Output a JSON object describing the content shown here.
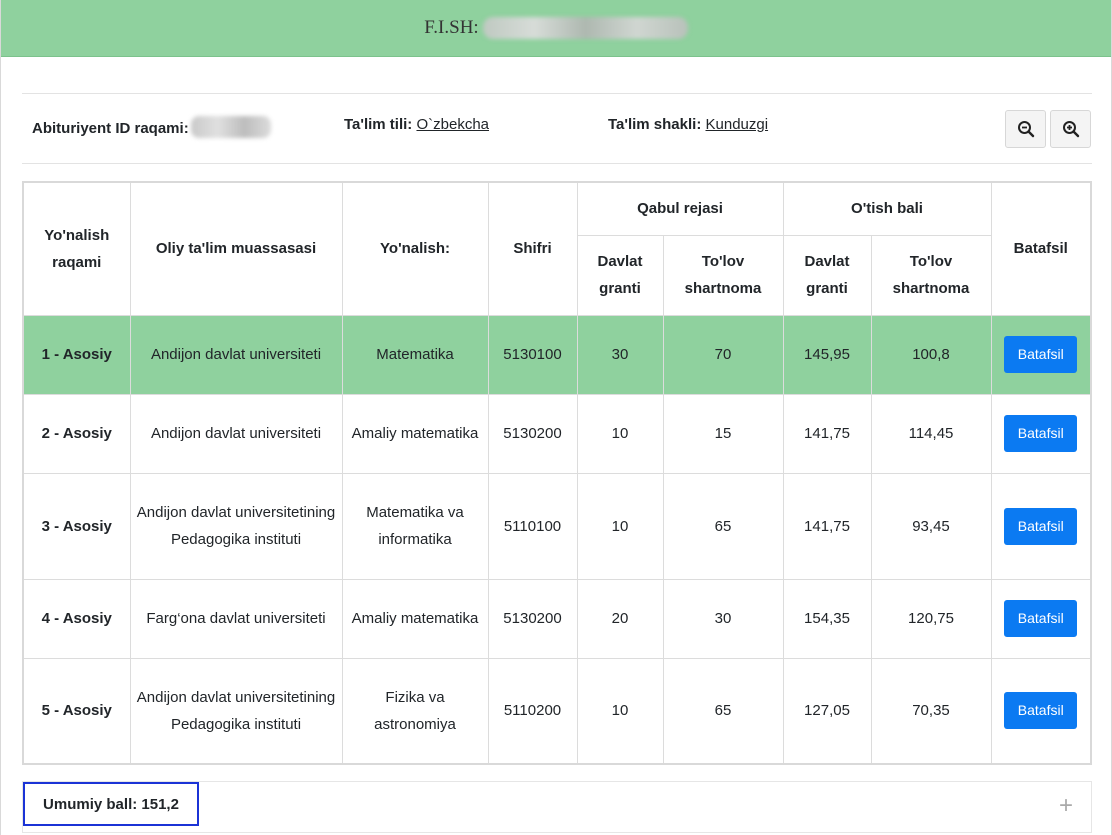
{
  "header": {
    "label": "F.I.SH:"
  },
  "info": {
    "id_label": "Abituriyent ID raqami:",
    "lang_label": "Ta'lim tili:",
    "lang_value": "O`zbekcha",
    "form_label": "Ta'lim shakli:",
    "form_value": "Kunduzgi"
  },
  "icons": {
    "zoom_out": "zoom-out-icon",
    "zoom_in": "zoom-in-icon",
    "expand": "plus-icon"
  },
  "table": {
    "headers": {
      "num": "Yo'nalish raqami",
      "oty": "Oliy ta'lim muassasasi",
      "dir": "Yo'nalish:",
      "code": "Shifri",
      "plan": "Qabul rejasi",
      "pass": "O'tish bali",
      "detail": "Batafsil",
      "grant": "Davlat granti",
      "contract": "To'lov shartnoma",
      "grant2": "Davlat granti",
      "contract2": "To'lov shartnoma"
    },
    "rows": [
      {
        "rank": "1 - Asosiy",
        "oty": "Andijon davlat universiteti",
        "dir": "Matematika",
        "code": "5130100",
        "plan_grant": "30",
        "plan_contract": "70",
        "pass_grant": "145,95",
        "pass_contract": "100,8",
        "button": "Batafsil"
      },
      {
        "rank": "2 - Asosiy",
        "oty": "Andijon davlat universiteti",
        "dir": "Amaliy matematika",
        "code": "5130200",
        "plan_grant": "10",
        "plan_contract": "15",
        "pass_grant": "141,75",
        "pass_contract": "114,45",
        "button": "Batafsil"
      },
      {
        "rank": "3 - Asosiy",
        "oty": "Andijon davlat universitetining Pedagogika instituti",
        "dir": "Matematika va informatika",
        "code": "5110100",
        "plan_grant": "10",
        "plan_contract": "65",
        "pass_grant": "141,75",
        "pass_contract": "93,45",
        "button": "Batafsil"
      },
      {
        "rank": "4 - Asosiy",
        "oty": "Farg‘ona davlat universiteti",
        "dir": "Amaliy matematika",
        "code": "5130200",
        "plan_grant": "20",
        "plan_contract": "30",
        "pass_grant": "154,35",
        "pass_contract": "120,75",
        "button": "Batafsil"
      },
      {
        "rank": "5 - Asosiy",
        "oty": "Andijon davlat universitetining Pedagogika instituti",
        "dir": "Fizika va astronomiya",
        "code": "5110200",
        "plan_grant": "10",
        "plan_contract": "65",
        "pass_grant": "127,05",
        "pass_contract": "70,35",
        "button": "Batafsil"
      }
    ]
  },
  "footer": {
    "total": "Umumiy ball: 151,2",
    "expand_symbol": "+"
  },
  "colors": {
    "header_bg": "#8fd19e",
    "highlight_row": "#8fd19e",
    "button": "#0b7af2",
    "total_border": "#1b33d6"
  }
}
